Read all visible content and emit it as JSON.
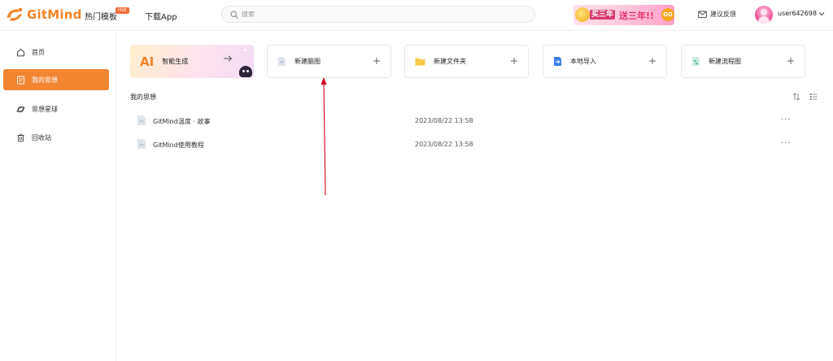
{
  "header": {
    "brand": "GitMind",
    "nav": [
      {
        "label": "热门模板",
        "badge": "Hot"
      },
      {
        "label": "下载App"
      }
    ],
    "search": {
      "placeholder": "搜索",
      "icon": "search-icon"
    },
    "promo": {
      "text_left": "买三年",
      "text_right": "送三年!!",
      "go": "GO"
    },
    "feedback": {
      "label": "建议反馈",
      "icon": "message-icon"
    },
    "user": {
      "name": "user642698",
      "icon": "chevron-down-icon"
    }
  },
  "sidebar": {
    "items": [
      {
        "label": "首页",
        "icon": "home-icon",
        "active": false
      },
      {
        "label": "我的思想",
        "icon": "document-icon",
        "active": true
      },
      {
        "label": "思想星球",
        "icon": "planet-icon",
        "active": false
      },
      {
        "label": "回收站",
        "icon": "trash-icon",
        "active": false
      }
    ]
  },
  "cards": [
    {
      "label": "智能生成",
      "icon": "ai-icon",
      "action": "arrow-right-icon"
    },
    {
      "label": "新建脑图",
      "icon": "mindmap-file-icon",
      "action": "plus-icon"
    },
    {
      "label": "新建文件夹",
      "icon": "folder-icon",
      "action": "plus-icon"
    },
    {
      "label": "本地导入",
      "icon": "import-icon",
      "action": "plus-icon"
    },
    {
      "label": "新建流程图",
      "icon": "flowchart-file-icon",
      "action": "plus-icon"
    }
  ],
  "files": {
    "title": "我的思想",
    "rows": [
      {
        "name": "GitMind温度 · 故事",
        "date": "2023/08/22 13:58"
      },
      {
        "name": "GitMind使用教程",
        "date": "2023/08/22 13:58"
      }
    ],
    "more": "···"
  },
  "colors": {
    "brand": "#f28325",
    "active": "#f38531",
    "annotation": "#d0021b"
  },
  "labels": {
    "ai_mark": "AI"
  }
}
